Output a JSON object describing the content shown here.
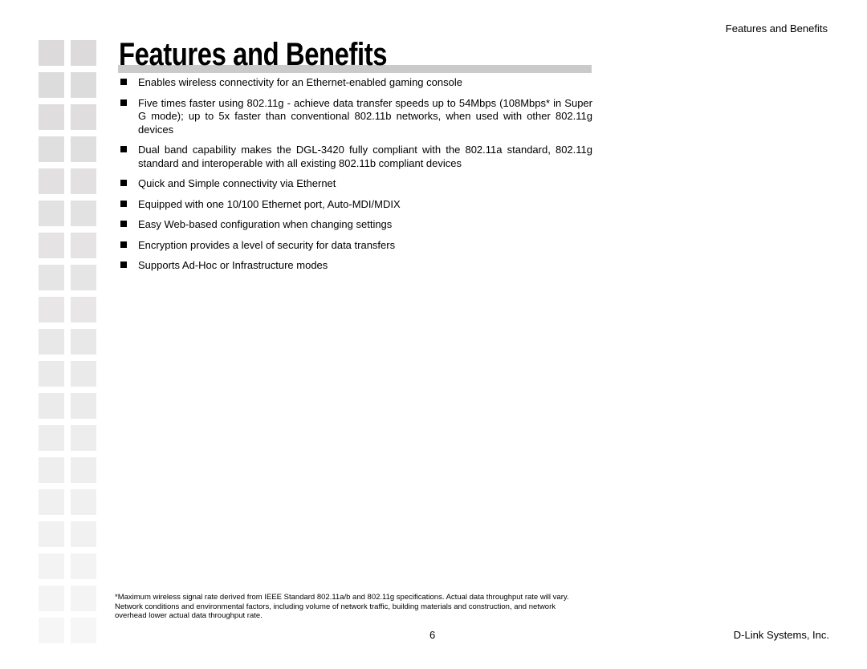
{
  "header": {
    "section_label": "Features and Benefits"
  },
  "title": "Features and Benefits",
  "features": [
    "Enables wireless connectivity for an Ethernet-enabled gaming console",
    "Five times faster using 802.11g - achieve data transfer speeds up to 54Mbps (108Mbps* in Super G mode); up to 5x faster than conventional 802.11b networks, when used with other 802.11g devices",
    "Dual band capability makes the DGL-3420 fully compliant with the 802.11a standard, 802.11g standard and interoperable with all existing 802.11b compliant  devices",
    "Quick and Simple connectivity via Ethernet",
    "Equipped with one 10/100 Ethernet port, Auto-MDI/MDIX",
    "Easy Web-based configuration when changing settings",
    "Encryption provides a level of security for data transfers",
    "Supports Ad-Hoc or Infrastructure modes"
  ],
  "footnote": "*Maximum wireless signal rate derived from IEEE Standard 802.11a/b and 802.11g specifications. Actual data throughput rate will vary. Network conditions and environmental factors, including volume of network traffic, building materials and construction, and network overhead lower actual data throughput rate.",
  "footer": {
    "page_number": "6",
    "company": "D-Link Systems, Inc."
  },
  "colors": {
    "square_top": "#dcdada",
    "square_bottom": "#f6f6f6",
    "title_bar": "#cacaca"
  }
}
